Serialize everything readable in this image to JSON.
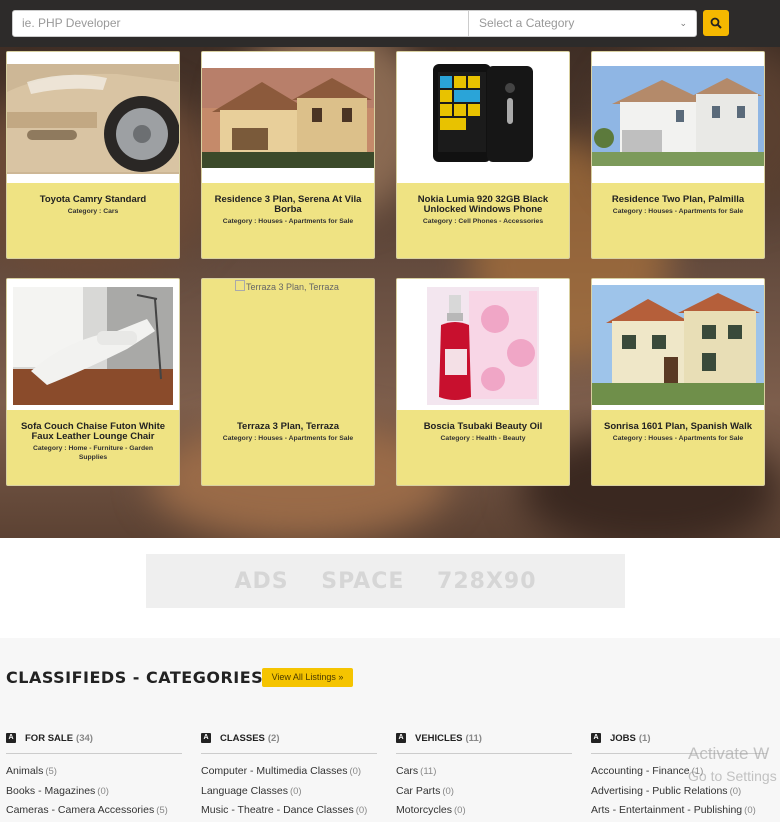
{
  "search": {
    "placeholder": "ie. PHP Developer",
    "category_placeholder": "Select a Category",
    "icon": "search-icon"
  },
  "listings": [
    {
      "title": "Toyota Camry Standard",
      "category": "Category : Cars",
      "image": "car-photo"
    },
    {
      "title": "Residence 3 Plan, Serena At Vila Borba",
      "category": "Category : Houses - Apartments for Sale",
      "image": "house-photo"
    },
    {
      "title": "Nokia Lumia 920 32GB Black Unlocked Windows Phone",
      "category": "Category : Cell Phones - Accessories",
      "image": "phone-photo"
    },
    {
      "title": "Residence Two Plan, Palmilla",
      "category": "Category : Houses - Apartments for Sale",
      "image": "house-photo"
    },
    {
      "title": "Sofa Couch Chaise Futon White Faux Leather Lounge Chair",
      "category": "Category : Home - Furniture - Garden Supplies",
      "image": "sofa-photo"
    },
    {
      "title": "Terraza 3 Plan, Terraza",
      "category": "Category : Houses - Apartments for Sale",
      "image_alt": "Terraza 3 Plan, Terraza"
    },
    {
      "title": "Boscia Tsubaki Beauty Oil",
      "category": "Category : Health - Beauty",
      "image": "beauty-oil-photo"
    },
    {
      "title": "Sonrisa 1601 Plan, Spanish Walk",
      "category": "Category : Houses - Apartments for Sale",
      "image": "house-photo"
    }
  ],
  "ads": {
    "text": "ADS SPACE 728X90"
  },
  "categories_section": {
    "title": "CLASSIFIEDS - CATEGORIES",
    "view_all_label": "View All Listings »",
    "columns": [
      {
        "name": "FOR SALE",
        "count": "(34)",
        "items": [
          {
            "label": "Animals",
            "count": "(5)"
          },
          {
            "label": "Books - Magazines",
            "count": "(0)"
          },
          {
            "label": "Cameras - Camera Accessories",
            "count": "(5)"
          }
        ]
      },
      {
        "name": "CLASSES",
        "count": "(2)",
        "items": [
          {
            "label": "Computer - Multimedia Classes",
            "count": "(0)"
          },
          {
            "label": "Language Classes",
            "count": "(0)"
          },
          {
            "label": "Music - Theatre - Dance Classes",
            "count": "(0)"
          }
        ]
      },
      {
        "name": "VEHICLES",
        "count": "(11)",
        "items": [
          {
            "label": "Cars",
            "count": "(11)"
          },
          {
            "label": "Car Parts",
            "count": "(0)"
          },
          {
            "label": "Motorcycles",
            "count": "(0)"
          }
        ]
      },
      {
        "name": "JOBS",
        "count": "(1)",
        "items": [
          {
            "label": "Accounting - Finance",
            "count": "(1)"
          },
          {
            "label": "Advertising - Public Relations",
            "count": "(0)"
          },
          {
            "label": "Arts - Entertainment - Publishing",
            "count": "(0)"
          }
        ]
      }
    ]
  },
  "os_watermark": {
    "line1": "Activate W",
    "line2": "Go to Settings"
  },
  "colors": {
    "accent": "#f5c400",
    "card": "#efe383",
    "topbar": "#2d2b2a"
  }
}
